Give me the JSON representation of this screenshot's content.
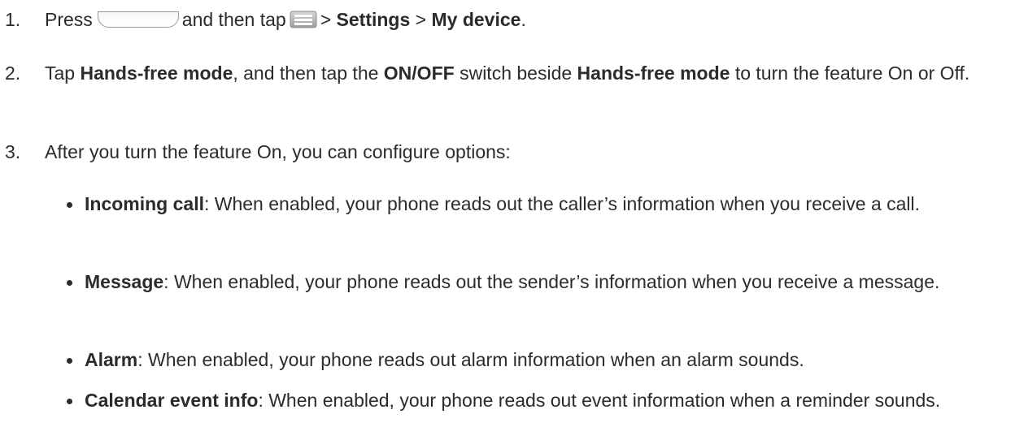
{
  "steps": [
    {
      "number": "1.",
      "t1": "Press",
      "t2": "and then tap",
      "t3": ">",
      "b1": "Settings",
      "t4": ">",
      "b2": "My device",
      "t5": "."
    },
    {
      "number": "2.",
      "t1": "Tap",
      "b1": "Hands-free mode",
      "t2": ", and then tap the",
      "b2": "ON/OFF",
      "t3": "switch beside",
      "b3": "Hands-free mode",
      "t4": "to turn the feature On or Off."
    },
    {
      "number": "3.",
      "text": "After you turn the feature On, you can configure options:"
    }
  ],
  "options": [
    {
      "name": "Incoming call",
      "desc": ": When enabled, your phone reads out the caller’s information when you receive a call."
    },
    {
      "name": "Message",
      "desc": ": When enabled, your phone reads out the sender’s information when you receive a message."
    },
    {
      "name": "Alarm",
      "desc": ": When enabled, your phone reads out alarm information when an alarm sounds."
    },
    {
      "name": "Calendar event info",
      "desc": ": When enabled, your phone reads out event information when a reminder sounds."
    }
  ],
  "icons": {
    "home_key": "home-key-icon",
    "menu_key": "menu-key-icon"
  }
}
